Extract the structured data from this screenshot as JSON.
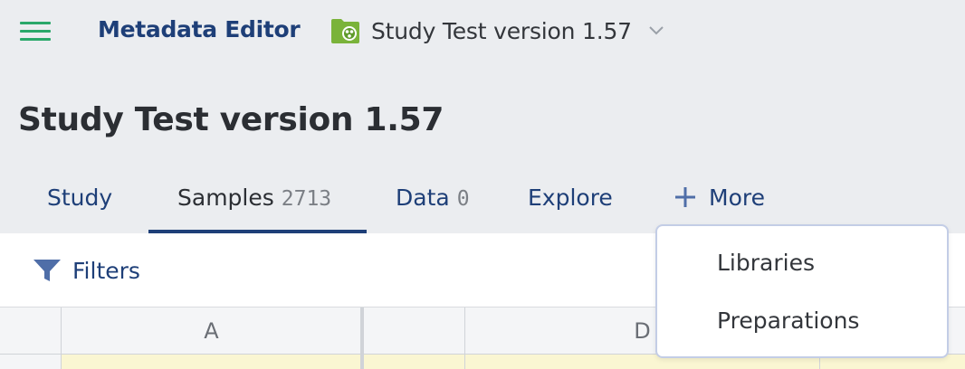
{
  "header": {
    "app_title": "Metadata Editor",
    "study_selector_label": "Study Test version 1.57",
    "menu_icon": "hamburger-menu-icon",
    "study_icon": "folder-icon",
    "dropdown_icon": "chevron-down-icon"
  },
  "page": {
    "title": "Study Test version 1.57"
  },
  "tabs": [
    {
      "label": "Study",
      "count": null,
      "active": false
    },
    {
      "label": "Samples",
      "count": "2713",
      "active": true
    },
    {
      "label": "Data",
      "count": "0",
      "active": false
    },
    {
      "label": "Explore",
      "count": null,
      "active": false
    },
    {
      "label": "More",
      "icon": "plus-icon",
      "active": false
    }
  ],
  "toolbar": {
    "filters_label": "Filters",
    "filters_icon": "filter-icon"
  },
  "grid": {
    "columns": [
      "",
      "A",
      "",
      "D",
      ""
    ]
  },
  "more_menu": {
    "items": [
      "Libraries",
      "Preparations"
    ]
  },
  "colors": {
    "accent": "#1e3f78",
    "menu_green": "#2aa86a",
    "folder_green": "#7ab33a",
    "row_highlight": "#faf6d2",
    "background": "#ebedf0"
  }
}
